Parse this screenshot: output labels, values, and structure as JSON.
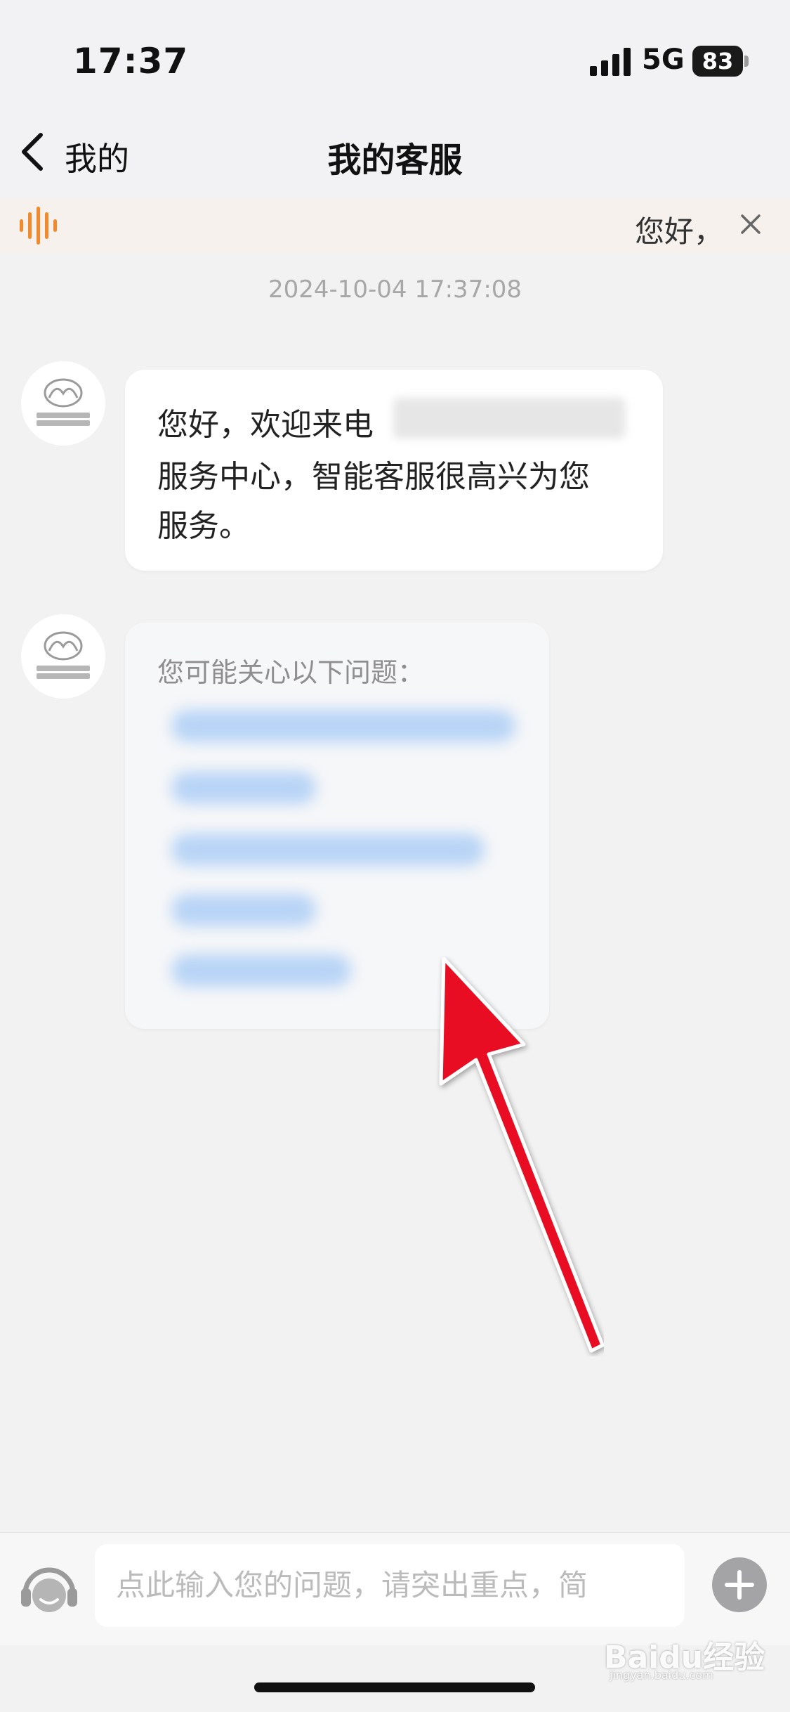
{
  "status_bar": {
    "time": "17:37",
    "network": "5G",
    "battery": "83"
  },
  "nav": {
    "back_label": "我的",
    "title": "我的客服"
  },
  "notice": {
    "text": "您好，"
  },
  "chat": {
    "timestamp": "2024-10-04 17:37:08",
    "welcome_lines": [
      "您好，欢迎来电",
      "服务中心，智能客服很高兴为您",
      "服务。"
    ],
    "faq_title": "您可能关心以下问题："
  },
  "input": {
    "placeholder": "点此输入您的问题，请突出重点，简"
  },
  "watermark": {
    "brand": "Baidu经验",
    "url": "jingyan.baidu.com"
  },
  "colors": {
    "accent_orange": "#f08a2c",
    "faq_link_blue": "#b8d4f6",
    "arrow_red": "#e81020"
  }
}
